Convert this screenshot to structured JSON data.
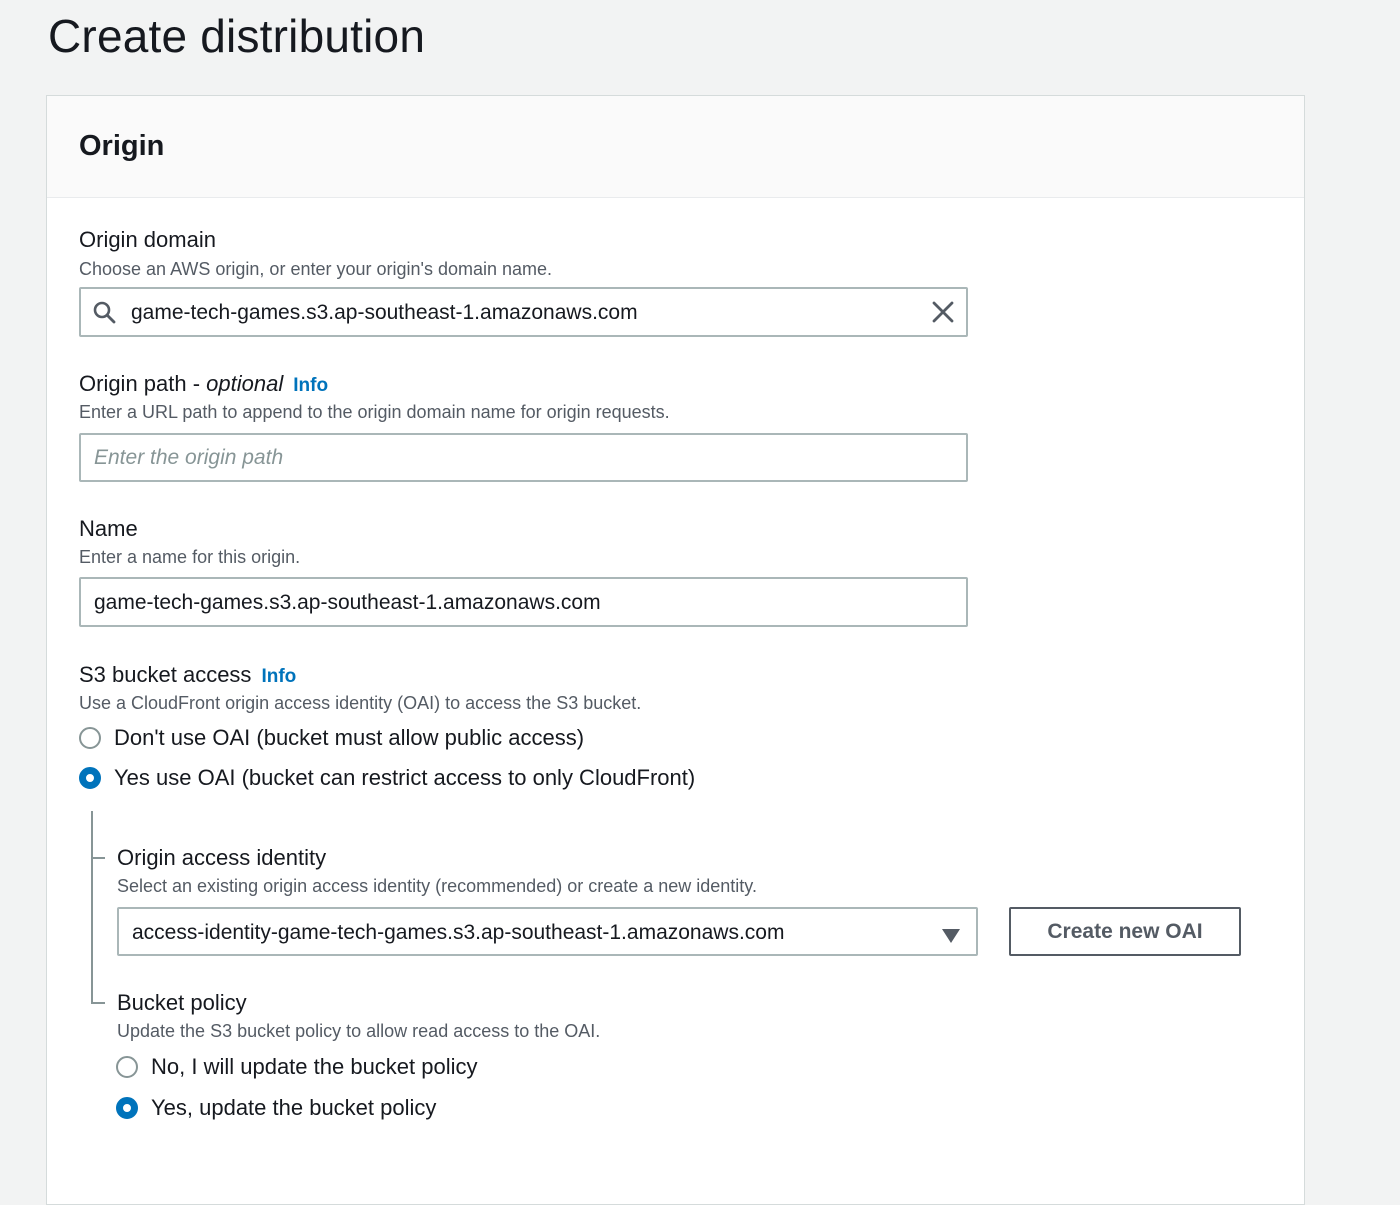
{
  "page": {
    "title": "Create distribution"
  },
  "origin": {
    "section_title": "Origin",
    "domain": {
      "label": "Origin domain",
      "description": "Choose an AWS origin, or enter your origin's domain name.",
      "value": "game-tech-games.s3.ap-southeast-1.amazonaws.com",
      "icons": [
        "search-icon",
        "clear-icon"
      ]
    },
    "path": {
      "label": "Origin path - ",
      "label_optional": "optional",
      "info": "Info",
      "description": "Enter a URL path to append to the origin domain name for origin requests.",
      "placeholder": "Enter the origin path"
    },
    "name": {
      "label": "Name",
      "description": "Enter a name for this origin.",
      "value": "game-tech-games.s3.ap-southeast-1.amazonaws.com"
    },
    "s3_access": {
      "label": "S3 bucket access",
      "info": "Info",
      "description": "Use a CloudFront origin access identity (OAI) to access the S3 bucket.",
      "options": [
        {
          "label": "Don't use OAI (bucket must allow public access)",
          "checked": false
        },
        {
          "label": "Yes use OAI (bucket can restrict access to only CloudFront)",
          "checked": true
        }
      ]
    },
    "oai": {
      "label": "Origin access identity",
      "description": "Select an existing origin access identity (recommended) or create a new identity.",
      "selected": "access-identity-game-tech-games.s3.ap-southeast-1.amazonaws.com",
      "create_button": "Create new OAI"
    },
    "bucket_policy": {
      "label": "Bucket policy",
      "description": "Update the S3 bucket policy to allow read access to the OAI.",
      "options": [
        {
          "label": "No, I will update the bucket policy",
          "checked": false
        },
        {
          "label": "Yes, update the bucket policy",
          "checked": true
        }
      ]
    }
  },
  "colors": {
    "accent": "#0073bb",
    "page_bg": "#f2f3f3",
    "panel_bg": "#ffffff",
    "text": "#16191f",
    "secondary_text": "#545b64"
  }
}
